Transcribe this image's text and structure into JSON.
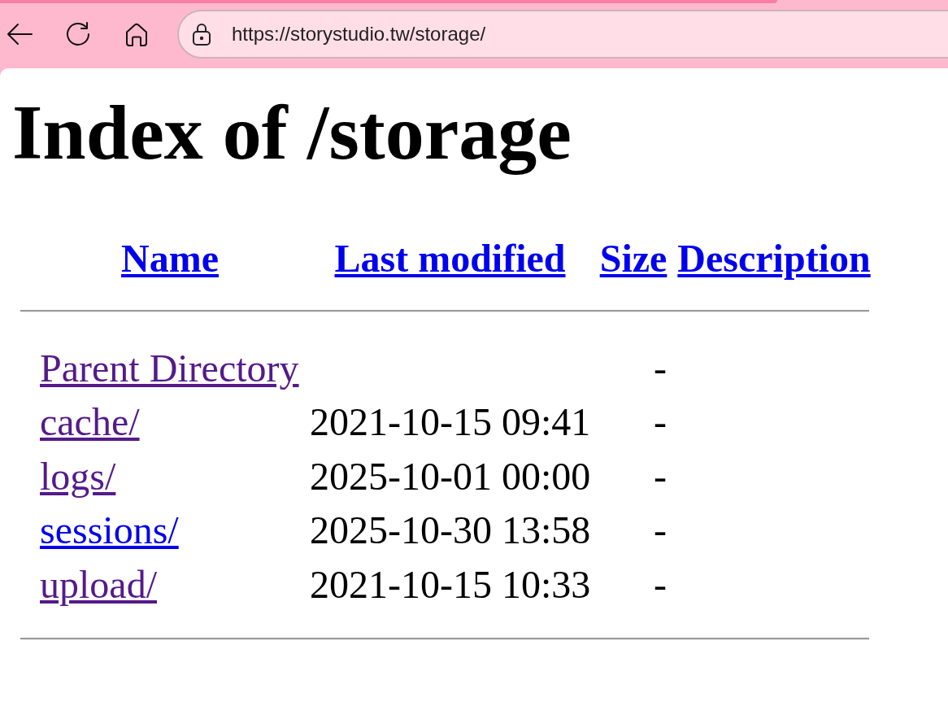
{
  "browser": {
    "url": "https://storystudio.tw/storage/"
  },
  "page": {
    "title": "Index of /storage",
    "table": {
      "columns": [
        {
          "label": "Name",
          "visited": false
        },
        {
          "label": "Last modified",
          "visited": false
        },
        {
          "label": "Size",
          "visited": false
        },
        {
          "label": "Description",
          "visited": false
        }
      ],
      "rows": [
        {
          "name": "Parent Directory",
          "visited": true,
          "size": "-"
        },
        {
          "name": "cache/",
          "visited": true,
          "last_modified": "2021-10-15 09:41",
          "size": "-"
        },
        {
          "name": "logs/",
          "visited": true,
          "last_modified": "2025-10-01 00:00",
          "size": "-"
        },
        {
          "name": "sessions/",
          "visited": false,
          "last_modified": "2025-10-30 13:58",
          "size": "-"
        },
        {
          "name": "upload/",
          "visited": true,
          "last_modified": "2021-10-15 10:33",
          "size": "-"
        }
      ]
    }
  }
}
